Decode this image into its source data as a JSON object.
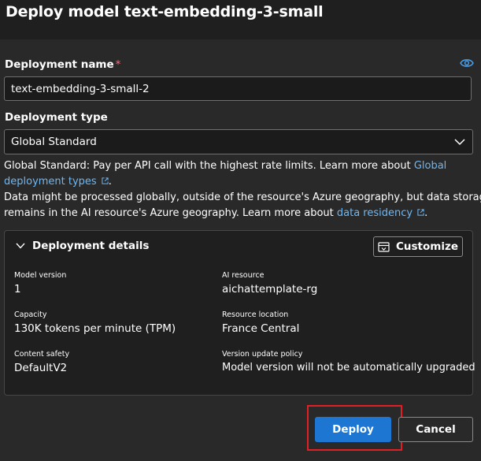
{
  "dialog": {
    "title": "Deploy model text-embedding-3-small"
  },
  "deployment_name": {
    "label": "Deployment name",
    "required_marker": "*",
    "value": "text-embedding-3-small-2"
  },
  "deployment_type": {
    "label": "Deployment type",
    "selected": "Global Standard",
    "description_prefix": "Global Standard: Pay per API call with the highest rate limits. Learn more about ",
    "description_link_line1": "Global",
    "description_link_line2": "deployment types",
    "description_link_suffix": ".",
    "data_note_line1": "Data might be processed globally, outside of the resource's Azure geography, but data storage",
    "data_note_line2_prefix": "remains in the AI resource's Azure geography. Learn more about ",
    "data_note_link": "data residency",
    "data_note_suffix": "."
  },
  "details": {
    "header": "Deployment details",
    "customize_label": "Customize",
    "fields": [
      {
        "label": "Model version",
        "value": "1"
      },
      {
        "label": "AI resource",
        "value": "aichattemplate-rg"
      },
      {
        "label": "Capacity",
        "value": "130K tokens per minute (TPM)"
      },
      {
        "label": "Resource location",
        "value": "France Central"
      },
      {
        "label": "Content safety",
        "value": "DefaultV2"
      },
      {
        "label": "Version update policy",
        "value": "Model version will not be automatically upgraded"
      }
    ]
  },
  "actions": {
    "deploy_label": "Deploy",
    "cancel_label": "Cancel"
  },
  "colors": {
    "accent": "#1d76d2",
    "link": "#6cb8f6",
    "highlight": "#e31f26",
    "required": "#f1707b"
  },
  "icons": [
    "eye-icon",
    "chevron-down-icon",
    "external-link-icon",
    "collapse-chevron-icon",
    "customize-icon"
  ]
}
